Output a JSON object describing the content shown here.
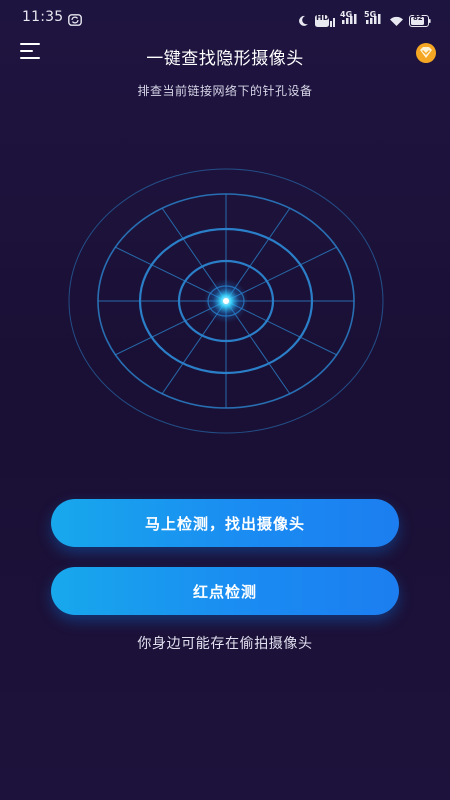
{
  "status_bar": {
    "time": "11:35",
    "hd_badge": "HD",
    "network_4g": "4G",
    "network_5g": "5G",
    "battery": "82",
    "icons": [
      "sync-icon",
      "moon-icon",
      "hd-icon",
      "signal-4g-icon",
      "signal-5g-icon",
      "wifi-icon",
      "battery-icon"
    ]
  },
  "header": {
    "title": "一键查找隐形摄像头",
    "subtitle": "排查当前链接网络下的针孔设备",
    "menu_icon": "menu-icon",
    "vip_icon": "vip-diamond-icon"
  },
  "radar": {
    "icon": "radar-icon"
  },
  "actions": {
    "scan_label": "马上检测，找出摄像头",
    "red_dot_label": "红点检测"
  },
  "footer": {
    "note": "你身边可能存在偷拍摄像头"
  },
  "colors": {
    "background": "#1c1238",
    "button_start": "#18a8ec",
    "button_end": "#1c7ef0",
    "radar_line": "#2a7fc8",
    "radar_glow": "#3ad6ff",
    "vip_badge": "#f5a623"
  }
}
